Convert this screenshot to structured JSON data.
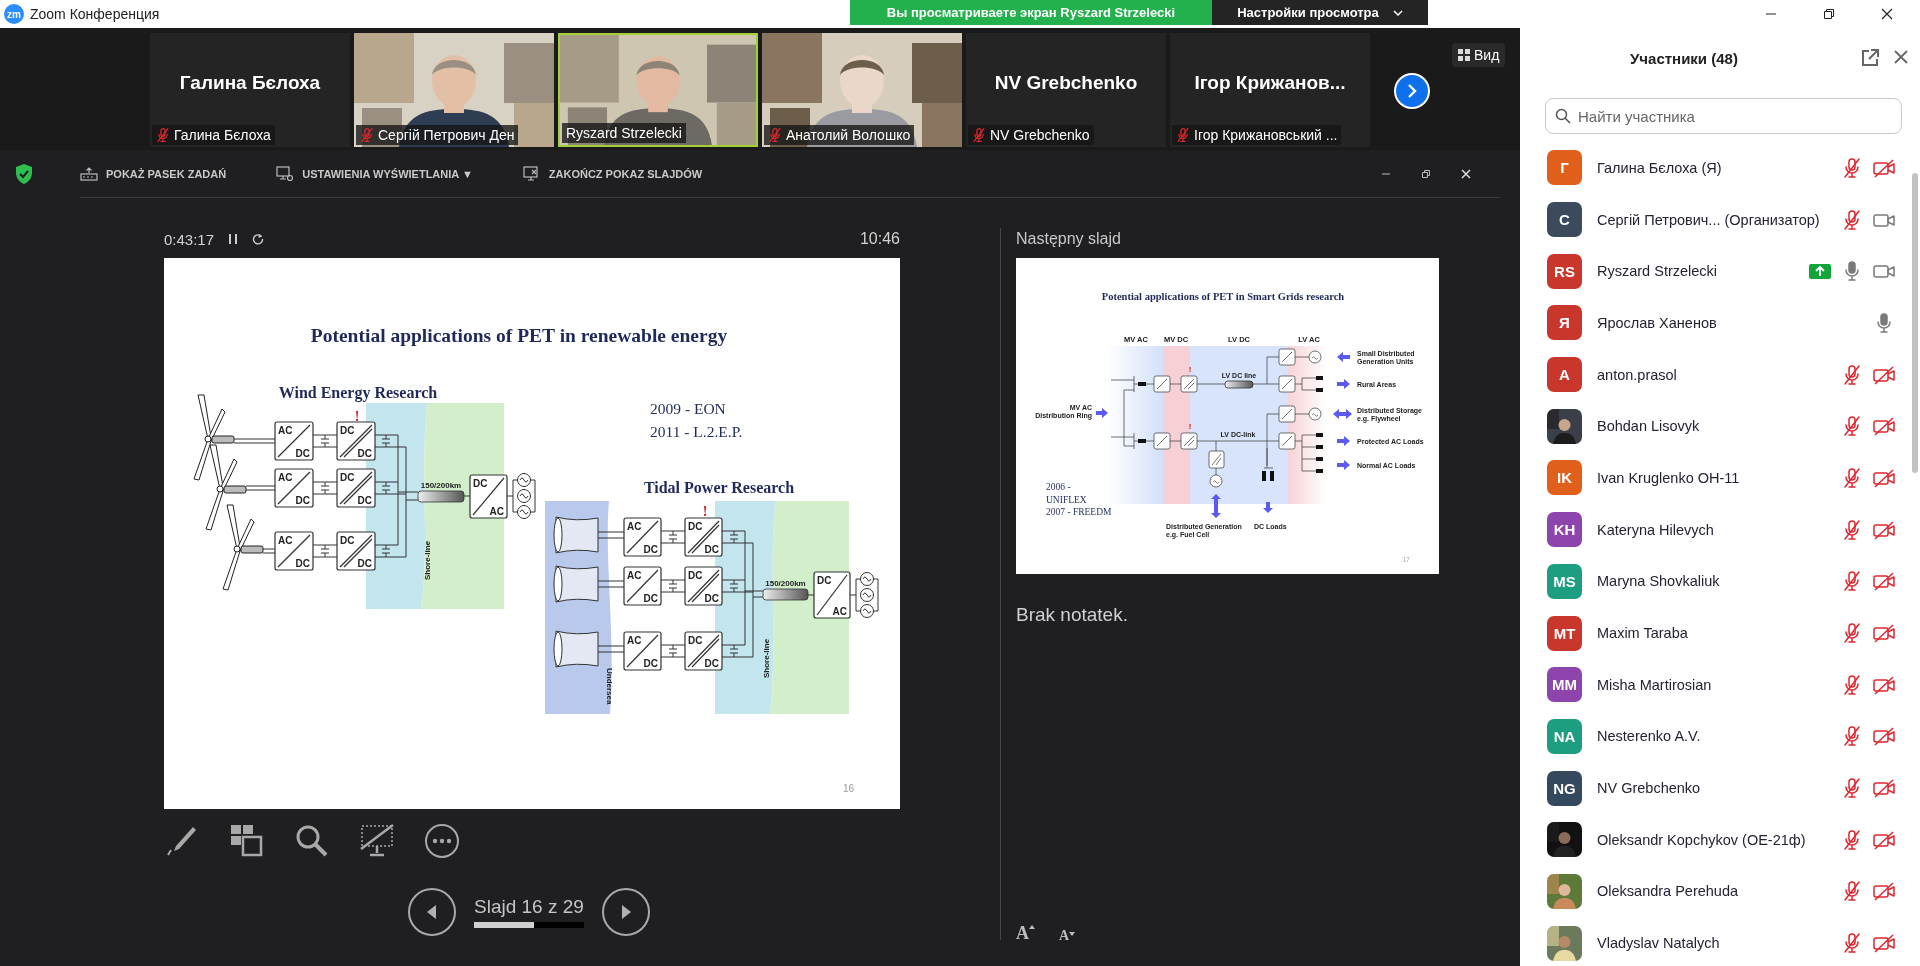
{
  "window": {
    "logo": "zm",
    "title": "Zoom Конференция"
  },
  "share_banner": {
    "text": "Вы просматриваете экран Ryszard Strzelecki",
    "options": "Настройки просмотра"
  },
  "video_strip": {
    "view_button": "Вид",
    "tiles": [
      {
        "kind": "name",
        "display_name": "Галина Бєлоха",
        "label": "Галина Бєлоха",
        "muted": true,
        "speaking": false
      },
      {
        "kind": "video",
        "label": "Сергій Петрович Ден",
        "muted": true,
        "speaking": false
      },
      {
        "kind": "video",
        "label": "Ryszard Strzelecki",
        "muted": false,
        "speaking": true
      },
      {
        "kind": "video",
        "label": "Анатолий Волошко",
        "muted": true,
        "speaking": false
      },
      {
        "kind": "name",
        "display_name": "NV Grebchenko",
        "label": "NV Grebchenko",
        "muted": true,
        "speaking": false
      },
      {
        "kind": "name",
        "display_name": "Ігор  Крижанов...",
        "label": "Ігор Крижановський ...",
        "muted": true,
        "speaking": false
      }
    ]
  },
  "presenter": {
    "toolbar": [
      {
        "kind": "taskbar",
        "label": "POKAŻ PASEK ZADAŃ"
      },
      {
        "kind": "display",
        "label": "USTAWIENIA WYŚWIETLANIA ▼"
      },
      {
        "kind": "end",
        "label": "ZAKOŃCZ POKAZ SLAJDÓW"
      }
    ],
    "elapsed": "0:43:17",
    "clock": "10:46",
    "slide": {
      "title": "Potential applications of PET in renewable energy",
      "years": [
        "2009 - EON",
        "2011 - L.2.E.P."
      ],
      "page": "16",
      "wind": {
        "heading": "Wind Energy Research",
        "marker": "!",
        "rows": [
          {
            "converters": [
              {
                "in": "AC",
                "out": "DC"
              },
              {
                "in": "DC",
                "out": "DC"
              }
            ]
          },
          {
            "converters": [
              {
                "in": "AC",
                "out": "DC"
              },
              {
                "in": "DC",
                "out": "DC"
              }
            ]
          },
          {
            "converters": [
              {
                "in": "AC",
                "out": "DC"
              },
              {
                "in": "DC",
                "out": "DC"
              }
            ]
          }
        ],
        "cable": "150/200km",
        "inverter": {
          "in": "DC",
          "out": "AC"
        },
        "shore": "Shore-line"
      },
      "tidal": {
        "heading": "Tidal Power Research",
        "marker": "!",
        "rows": [
          {
            "converters": [
              {
                "in": "AC",
                "out": "DC"
              },
              {
                "in": "DC",
                "out": "DC"
              }
            ]
          },
          {
            "converters": [
              {
                "in": "AC",
                "out": "DC"
              },
              {
                "in": "DC",
                "out": "DC"
              }
            ]
          },
          {
            "converters": [
              {
                "in": "AC",
                "out": "DC"
              },
              {
                "in": "DC",
                "out": "DC"
              }
            ]
          }
        ],
        "cable": "150/200km",
        "inverter": {
          "in": "DC",
          "out": "AC"
        },
        "shore": "Shore-line",
        "sea": "Undersea"
      }
    },
    "slide_counter": "Slajd 16 z 29",
    "progress": {
      "level": 0.55
    },
    "next_label": "Następny slajd",
    "next_slide": {
      "title": "Potential applications of PET in Smart Grids research",
      "zones": [
        "MV AC",
        "MV DC",
        "LV DC",
        "LV AC"
      ],
      "ring": [
        "MV AC",
        "Distribution Ring"
      ],
      "markers": [
        "!",
        "!"
      ],
      "dc_line": "LV DC line",
      "dc_link": "LV DC-link",
      "outputs": [
        {
          "kind": "source",
          "lines": [
            "Small Distributed",
            "Generation Units"
          ]
        },
        {
          "kind": "load",
          "lines": [
            "Rural Areas"
          ]
        },
        {
          "kind": "storage",
          "lines": [
            "Distributed Storage",
            "e.g. Flywheel"
          ]
        },
        {
          "kind": "load",
          "lines": [
            "Protected AC Loads"
          ]
        },
        {
          "kind": "load",
          "lines": [
            "Normal AC Loads"
          ]
        }
      ],
      "fuel_cell": [
        "Distributed Generation",
        "e.g. Fuel Cell"
      ],
      "dc_loads": "DC Loads",
      "years": [
        "2006 -",
        "UNIFLEX",
        "2007 - FREEDM"
      ],
      "page": "17"
    },
    "notes": "Brak notatek.",
    "font_buttons": [
      {
        "kind": "increase",
        "label": "A"
      },
      {
        "kind": "decrease",
        "label": "A"
      }
    ]
  },
  "participants": {
    "title": "Участники (48)",
    "search_placeholder": "Найти участника",
    "people": [
      {
        "name": "Галина Бєлоха (Я)",
        "avatar": {
          "kind": "initials",
          "text": "Г",
          "color": "#e0601b"
        },
        "sharing": false,
        "mic_muted": true,
        "video_on": false
      },
      {
        "name": "Сергій Петрович... (Организатор)",
        "avatar": {
          "kind": "initials",
          "text": "С",
          "color": "#3b4a5c"
        },
        "sharing": false,
        "mic_muted": true,
        "video_on": true
      },
      {
        "name": "Ryszard Strzelecki",
        "avatar": {
          "kind": "initials",
          "text": "RS",
          "color": "#c9372c"
        },
        "sharing": true,
        "mic_muted": false,
        "video_on": true
      },
      {
        "name": "Ярослав Ханенов",
        "avatar": {
          "kind": "initials",
          "text": "Я",
          "color": "#c9372c"
        },
        "sharing": false,
        "mic_muted": false
      },
      {
        "name": "anton.prasol",
        "avatar": {
          "kind": "initials",
          "text": "A",
          "color": "#c9372c"
        },
        "sharing": false,
        "mic_muted": true,
        "video_on": false
      },
      {
        "name": "Bohdan Lisovyk",
        "sharing": false,
        "mic_muted": true,
        "video_on": false
      },
      {
        "name": "Ivan Kruglenko ОН-11",
        "avatar": {
          "kind": "initials",
          "text": "IK",
          "color": "#e0601b"
        },
        "sharing": false,
        "mic_muted": true,
        "video_on": false
      },
      {
        "name": "Kateryna Hilevych",
        "avatar": {
          "kind": "initials",
          "text": "KH",
          "color": "#8e44ad"
        },
        "sharing": false,
        "mic_muted": true,
        "video_on": false
      },
      {
        "name": "Maryna Shovkaliuk",
        "avatar": {
          "kind": "initials",
          "text": "MS",
          "color": "#1e9e80"
        },
        "sharing": false,
        "mic_muted": true,
        "video_on": false
      },
      {
        "name": "Maxim Taraba",
        "avatar": {
          "kind": "initials",
          "text": "MT",
          "color": "#c9372c"
        },
        "sharing": false,
        "mic_muted": true,
        "video_on": false
      },
      {
        "name": "Misha Martirosian",
        "avatar": {
          "kind": "initials",
          "text": "MM",
          "color": "#8e44ad"
        },
        "sharing": false,
        "mic_muted": true,
        "video_on": false
      },
      {
        "name": "Nesterenko A.V.",
        "avatar": {
          "kind": "initials",
          "text": "NA",
          "color": "#1e9e80"
        },
        "sharing": false,
        "mic_muted": true,
        "video_on": false
      },
      {
        "name": "NV Grebchenko",
        "avatar": {
          "kind": "initials",
          "text": "NG",
          "color": "#34495e"
        },
        "sharing": false,
        "mic_muted": true,
        "video_on": false
      },
      {
        "name": "Oleksandr Kopchykov (ОЕ-21ф)",
        "sharing": false,
        "mic_muted": true,
        "video_on": false
      },
      {
        "name": "Oleksandra Perehuda",
        "sharing": false,
        "mic_muted": true,
        "video_on": false
      },
      {
        "name": "Vladyslav Natalych",
        "sharing": false,
        "mic_muted": true,
        "video_on": false
      }
    ]
  }
}
